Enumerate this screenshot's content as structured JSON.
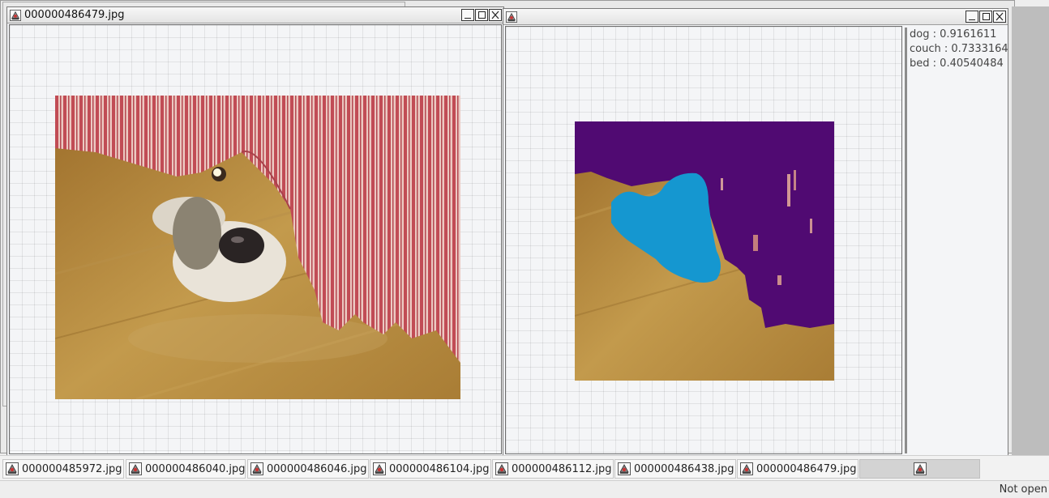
{
  "window_left": {
    "title": "000000486479.jpg"
  },
  "window_right": {
    "title": ""
  },
  "scores": [
    {
      "label": "dog",
      "value": "0.9161611"
    },
    {
      "label": "couch",
      "value": "0.7333164"
    },
    {
      "label": "bed",
      "value": "0.40540484"
    }
  ],
  "taskbar": [
    {
      "label": "000000485972.jpg"
    },
    {
      "label": "000000486040.jpg"
    },
    {
      "label": "000000486046.jpg"
    },
    {
      "label": "000000486104.jpg"
    },
    {
      "label": "000000486112.jpg"
    },
    {
      "label": "000000486438.jpg"
    },
    {
      "label": "000000486479.jpg"
    },
    {
      "label": ""
    }
  ],
  "status": "Not open",
  "colors": {
    "mask_dog": "#1597d0",
    "mask_couch": "#500a72",
    "curtain_red": "#c7545c",
    "floor_wood": "#b68a3e"
  }
}
